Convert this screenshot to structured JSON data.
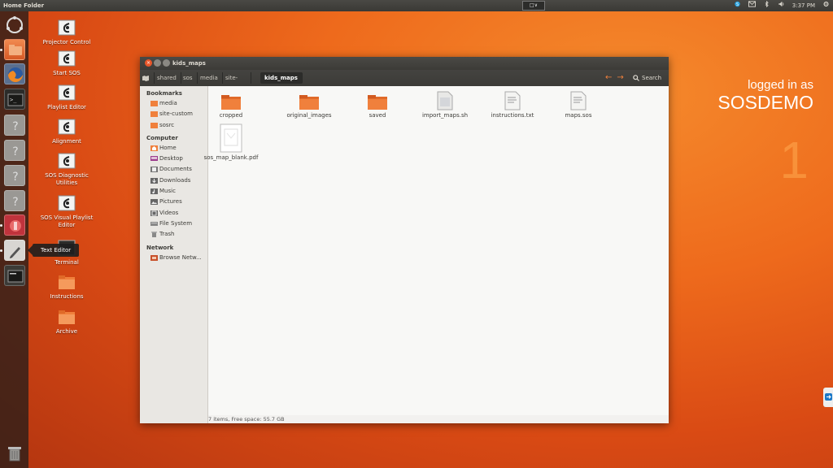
{
  "top_panel": {
    "title": "Home Folder",
    "keyboard": "□∨",
    "time": "3:37 PM",
    "tray_icons": [
      "skype-icon",
      "mail-icon",
      "bluetooth-icon",
      "volume-icon",
      "gear-icon"
    ]
  },
  "launcher": {
    "items": [
      {
        "name": "ubuntu-dash-icon"
      },
      {
        "name": "files-icon"
      },
      {
        "name": "firefox-icon"
      },
      {
        "name": "terminal-icon"
      },
      {
        "name": "unknown-app-icon"
      },
      {
        "name": "unknown-app-icon"
      },
      {
        "name": "unknown-app-icon"
      },
      {
        "name": "unknown-app-icon"
      },
      {
        "name": "presentation-app-icon"
      },
      {
        "name": "text-editor-icon"
      },
      {
        "name": "terminal-icon"
      },
      {
        "name": "trash-icon"
      }
    ],
    "tooltip": "Text Editor"
  },
  "desktop": {
    "icons": [
      {
        "label": "Projector Control",
        "icon": "sos-icon"
      },
      {
        "label": "Start SOS",
        "icon": "sos-icon"
      },
      {
        "label": "Playlist Editor",
        "icon": "sos-icon"
      },
      {
        "label": "Alignment",
        "icon": "sos-icon"
      },
      {
        "label": "SOS Diagnostic Utilities",
        "icon": "sos-icon"
      },
      {
        "label": "SOS Visual Playlist Editor",
        "icon": "sos-icon"
      },
      {
        "label": "Terminal",
        "icon": "terminal-icon"
      },
      {
        "label": "Instructions",
        "icon": "folder-icon"
      },
      {
        "label": "Archive",
        "icon": "folder-icon"
      }
    ],
    "login_line1": "logged in as",
    "login_line2": "SOSDEMO",
    "workspace_number": "1"
  },
  "window": {
    "title": "kids_maps",
    "breadcrumbs": [
      "shared",
      "sos",
      "media",
      "site-custom",
      "kids_maps"
    ],
    "search_label": "Search",
    "sidebar": {
      "bookmarks_header": "Bookmarks",
      "bookmarks": [
        "media",
        "site-custom",
        "sosrc"
      ],
      "computer_header": "Computer",
      "computer": [
        "Home",
        "Desktop",
        "Documents",
        "Downloads",
        "Music",
        "Pictures",
        "Videos",
        "File System",
        "Trash"
      ],
      "network_header": "Network",
      "network": [
        "Browse Netw..."
      ]
    },
    "files": [
      {
        "name": "cropped",
        "type": "folder"
      },
      {
        "name": "original_images",
        "type": "folder"
      },
      {
        "name": "saved",
        "type": "folder"
      },
      {
        "name": "import_maps.sh",
        "type": "script"
      },
      {
        "name": "instructions.txt",
        "type": "text"
      },
      {
        "name": "maps.sos",
        "type": "text"
      },
      {
        "name": "sos_map_blank.pdf",
        "type": "pdf"
      }
    ],
    "status": "7 items, Free space: 55.7 GB"
  },
  "colors": {
    "accent": "#e8562a",
    "folder": "#f0803c",
    "panel": "#3c3b37"
  }
}
